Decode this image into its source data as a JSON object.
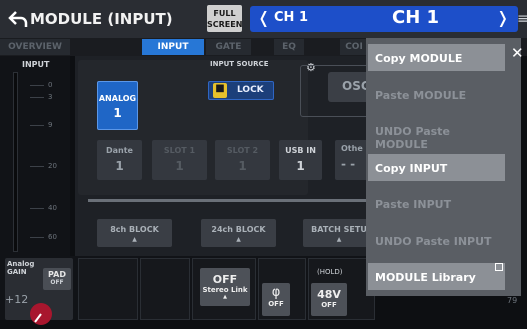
{
  "header": {
    "title": "MODULE (INPUT)",
    "fullscreen_line1": "FULL",
    "fullscreen_line2": "SCREEN",
    "channel_left": "CH 1",
    "channel_main": "CH 1"
  },
  "tabs": [
    "OVERVIEW",
    "INPUT",
    "GATE",
    "EQ",
    "COI"
  ],
  "meter": {
    "label": "INPUT",
    "scale": [
      "0",
      "3",
      "9",
      "20",
      "40",
      "60"
    ]
  },
  "input_source": {
    "label": "INPUT SOURCE",
    "lock_label": "LOCK",
    "analog": {
      "name": "ANALOG",
      "value": "1"
    },
    "sources": [
      {
        "name": "Dante",
        "value": "1"
      },
      {
        "name": "SLOT 1",
        "value": "1"
      },
      {
        "name": "SLOT 2",
        "value": "1"
      },
      {
        "name": "USB IN",
        "value": "1"
      },
      {
        "name": "Othe",
        "value": "- -"
      }
    ]
  },
  "osc_label": "OSC",
  "blocks": [
    "8ch BLOCK",
    "24ch BLOCK",
    "BATCH SETU"
  ],
  "bottom": {
    "analog_gain_line1": "Analog",
    "analog_gain_line2": "GAIN",
    "pad_label": "PAD",
    "pad_state": "OFF",
    "gain_value": "+12",
    "stereo_state": "OFF",
    "stereo_label": "Stereo Link",
    "phase_symbol": "φ",
    "phase_state": "OFF",
    "hold_label": "(HOLD)",
    "v48_label": "48V",
    "v48_state": "OFF",
    "right_value": "79"
  },
  "menu": {
    "items": [
      {
        "label": "Copy MODULE",
        "enabled": true
      },
      {
        "label": "Paste MODULE",
        "enabled": false
      },
      {
        "label": "UNDO Paste MODULE",
        "enabled": false
      },
      {
        "label": "Copy INPUT",
        "enabled": true
      },
      {
        "label": "Paste INPUT",
        "enabled": false
      },
      {
        "label": "UNDO Paste INPUT",
        "enabled": false
      },
      {
        "label": "MODULE Library",
        "enabled": true
      }
    ]
  }
}
